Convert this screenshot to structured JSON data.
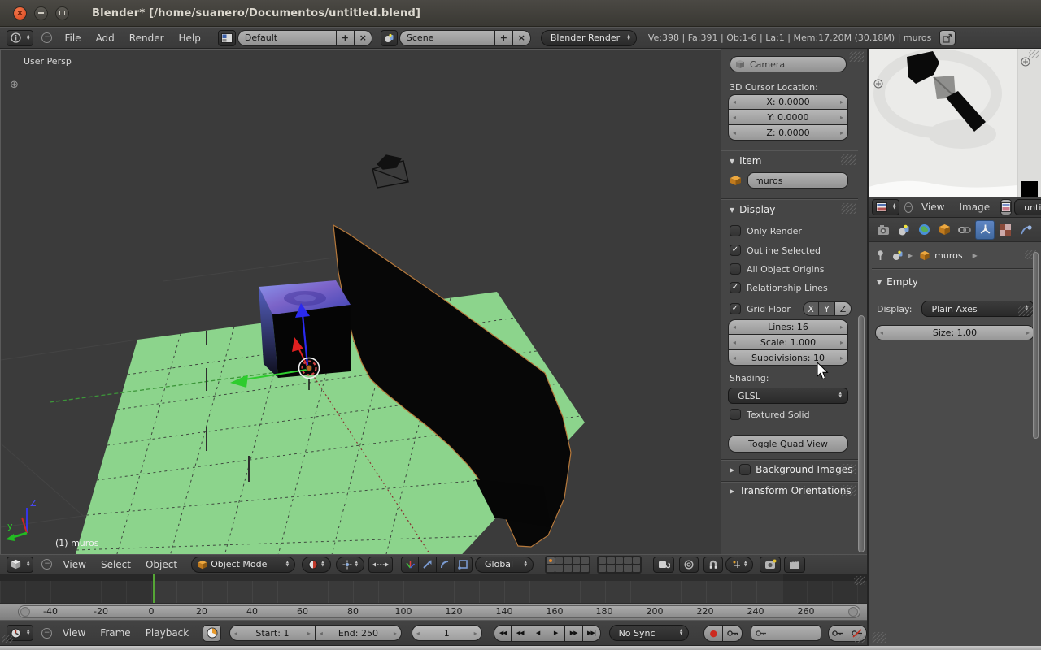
{
  "colors": {
    "accent_blue": "#4772b3",
    "selected_outline_orange": "#c87d2e",
    "ground_green": "#8cd48c",
    "frame_line_green": "#55a636",
    "close_button_orange": "#d9471f",
    "header_gray": "#3f3f3f",
    "viewport_gray": "#3b3b3b",
    "field_light": "#a9a9a9",
    "dropdown_dark": "#2e2e2e"
  },
  "window": {
    "title": "Blender* [/home/suanero/Documentos/untitled.blend]"
  },
  "infobar": {
    "menus": [
      "File",
      "Add",
      "Render",
      "Help"
    ],
    "layout": "Default",
    "scene": "Scene",
    "engine": "Blender Render",
    "stats": "Ve:398 | Fa:391 | Ob:1-6 | La:1 | Mem:17.20M (30.18M) | muros"
  },
  "viewport": {
    "view_label": "User Persp",
    "object_label": "(1) muros",
    "gizmo_y": "y",
    "gizmo_z": "Z"
  },
  "npanel": {
    "camera": "Camera",
    "cursor_title": "3D Cursor Location:",
    "cursor_x": "X: 0.0000",
    "cursor_y": "Y: 0.0000",
    "cursor_z": "Z: 0.0000",
    "item_title": "Item",
    "item_name": "muros",
    "display_title": "Display",
    "checks": [
      {
        "label": "Only Render",
        "on": false
      },
      {
        "label": "Outline Selected",
        "on": true
      },
      {
        "label": "All Object Origins",
        "on": false
      },
      {
        "label": "Relationship Lines",
        "on": true
      }
    ],
    "grid_floor": {
      "label": "Grid Floor",
      "on": true,
      "x": "X",
      "y": "Y",
      "z": "Z"
    },
    "lines": "Lines: 16",
    "scale": "Scale: 1.000",
    "subdivisions": "Subdivisions: 10",
    "shading_label": "Shading:",
    "shading_value": "GLSL",
    "textured_solid": {
      "label": "Textured Solid",
      "on": false
    },
    "quad_view": "Toggle Quad View",
    "background_images": {
      "label": "Background Images",
      "on": false
    },
    "transform_orientations": "Transform Orientations"
  },
  "image_editor": {
    "menus": [
      "View",
      "Image"
    ],
    "datablock": "unti"
  },
  "properties": {
    "object_name": "muros",
    "panel_title": "Empty",
    "display_label": "Display:",
    "display_value": "Plain Axes",
    "size": "Size: 1.00"
  },
  "view3d": {
    "menus": [
      "View",
      "Select",
      "Object"
    ],
    "mode": "Object Mode",
    "orientation": "Global"
  },
  "timeline": {
    "ruler": [
      "-40",
      "-20",
      "0",
      "20",
      "40",
      "60",
      "80",
      "100",
      "120",
      "140",
      "160",
      "180",
      "200",
      "220",
      "240",
      "260"
    ],
    "menus": [
      "View",
      "Frame",
      "Playback"
    ],
    "start": "Start: 1",
    "end": "End: 250",
    "frame": "1",
    "sync": "No Sync",
    "playback": [
      "|◀◀",
      "◀◀",
      "◀",
      "▶",
      "▶▶",
      "▶▶|"
    ]
  },
  "icons": {
    "check": "✓",
    "arrow_left": "◂",
    "arrow_right": "▸",
    "up": "▲",
    "down": "▼",
    "tri_down": "▼",
    "tri_right": "▶",
    "minus": "−",
    "close": "×",
    "plus": "+",
    "circle_plus": "⊕",
    "record_dot": "●"
  }
}
